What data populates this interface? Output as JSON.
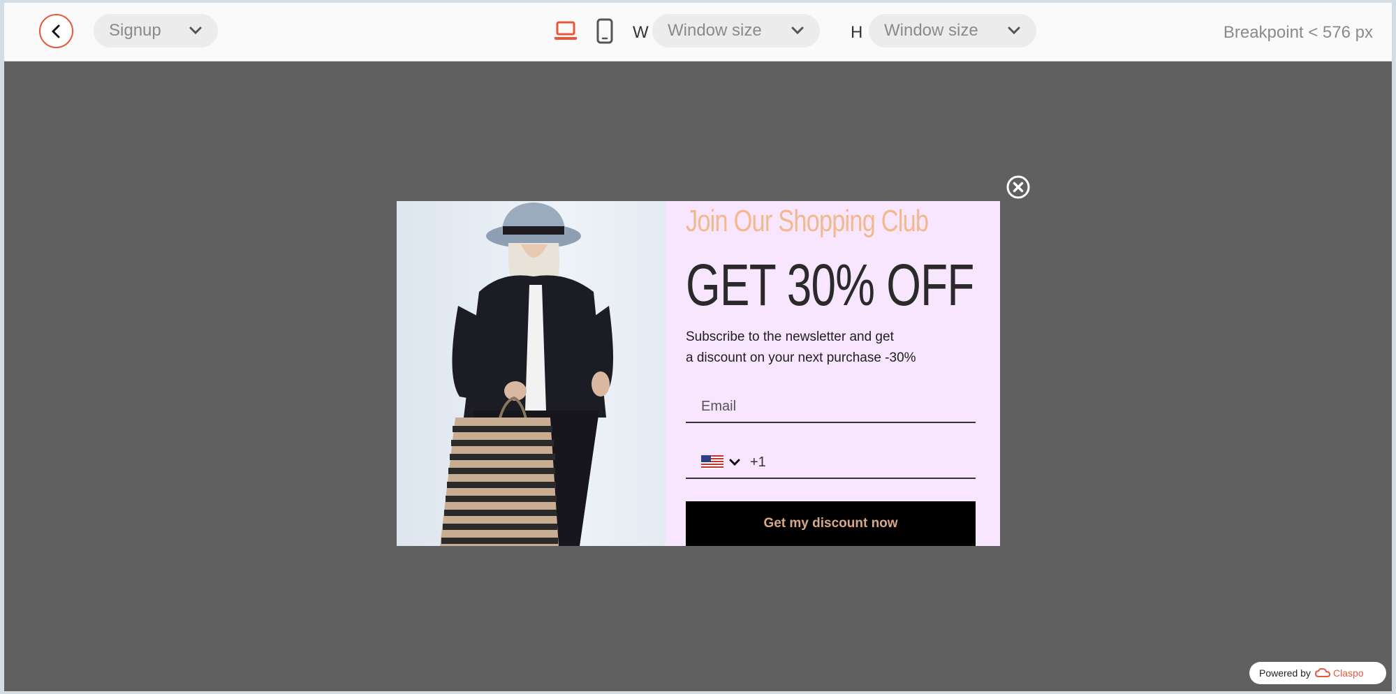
{
  "toolbar": {
    "page_select": "Signup",
    "width_label": "W",
    "width_value": "Window size",
    "height_label": "H",
    "height_value": "Window size",
    "breakpoint": "Breakpoint < 576 px"
  },
  "popup": {
    "club_title": "Join Our Shopping Club",
    "headline": "GET 30% OFF",
    "subtext_line1": "Subscribe to the newsletter and get",
    "subtext_line2": "a discount on your next purchase -30%",
    "email_placeholder": "Email",
    "phone_code": "+1",
    "submit_label": "Get my discount now"
  },
  "footer": {
    "powered_by": "Powered by",
    "brand": "Claspo"
  },
  "colors": {
    "accent": "#e8573c",
    "popup_bg": "#f8e6ff",
    "club_title": "#f2b98e",
    "button_text": "#d9a985"
  },
  "icons": {
    "back": "chevron-left-icon",
    "desktop": "laptop-icon",
    "mobile": "phone-icon",
    "dropdown": "chevron-down-icon",
    "close": "close-circle-icon",
    "flag": "us-flag-icon"
  }
}
